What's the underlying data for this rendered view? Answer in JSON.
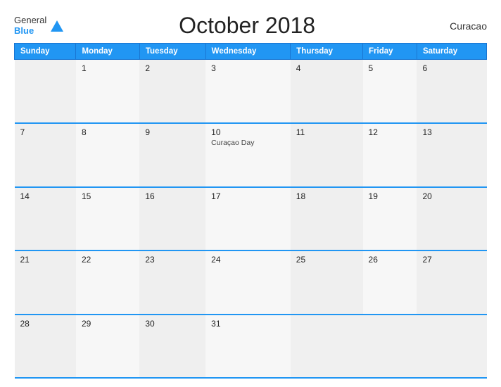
{
  "header": {
    "logo_line1": "General",
    "logo_line2": "Blue",
    "title": "October 2018",
    "region": "Curacao"
  },
  "weekdays": [
    "Sunday",
    "Monday",
    "Tuesday",
    "Wednesday",
    "Thursday",
    "Friday",
    "Saturday"
  ],
  "weeks": [
    [
      {
        "day": "",
        "event": ""
      },
      {
        "day": "1",
        "event": ""
      },
      {
        "day": "2",
        "event": ""
      },
      {
        "day": "3",
        "event": ""
      },
      {
        "day": "4",
        "event": ""
      },
      {
        "day": "5",
        "event": ""
      },
      {
        "day": "6",
        "event": ""
      }
    ],
    [
      {
        "day": "7",
        "event": ""
      },
      {
        "day": "8",
        "event": ""
      },
      {
        "day": "9",
        "event": ""
      },
      {
        "day": "10",
        "event": "Curaçao Day"
      },
      {
        "day": "11",
        "event": ""
      },
      {
        "day": "12",
        "event": ""
      },
      {
        "day": "13",
        "event": ""
      }
    ],
    [
      {
        "day": "14",
        "event": ""
      },
      {
        "day": "15",
        "event": ""
      },
      {
        "day": "16",
        "event": ""
      },
      {
        "day": "17",
        "event": ""
      },
      {
        "day": "18",
        "event": ""
      },
      {
        "day": "19",
        "event": ""
      },
      {
        "day": "20",
        "event": ""
      }
    ],
    [
      {
        "day": "21",
        "event": ""
      },
      {
        "day": "22",
        "event": ""
      },
      {
        "day": "23",
        "event": ""
      },
      {
        "day": "24",
        "event": ""
      },
      {
        "day": "25",
        "event": ""
      },
      {
        "day": "26",
        "event": ""
      },
      {
        "day": "27",
        "event": ""
      }
    ],
    [
      {
        "day": "28",
        "event": ""
      },
      {
        "day": "29",
        "event": ""
      },
      {
        "day": "30",
        "event": ""
      },
      {
        "day": "31",
        "event": ""
      },
      {
        "day": "",
        "event": ""
      },
      {
        "day": "",
        "event": ""
      },
      {
        "day": "",
        "event": ""
      }
    ]
  ],
  "colors": {
    "header_bg": "#2196F3",
    "row_separator": "#2196F3",
    "cell_odd": "#efefef",
    "cell_even": "#f7f7f7"
  }
}
